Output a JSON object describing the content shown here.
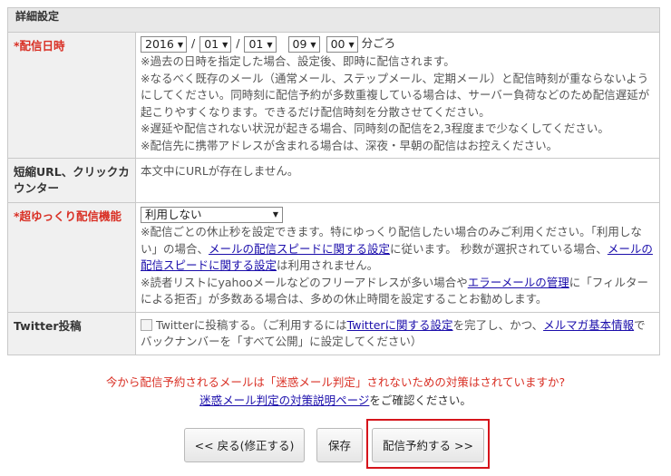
{
  "section": {
    "title": "詳細設定"
  },
  "rows": {
    "schedule": {
      "required_mark": "*",
      "label": "配信日時",
      "year": "2016",
      "month": "01",
      "day": "01",
      "hour": "09",
      "minute": "00",
      "sep_date": "/",
      "suffix": "分ごろ",
      "notes": [
        "※過去の日時を指定した場合、設定後、即時に配信されます。",
        "※なるべく既存のメール（通常メール、ステップメール、定期メール）と配信時刻が重ならないようにしてください。同時刻に配信予約が多数重複している場合は、サーバー負荷などのため配信遅延が起こりやすくなります。できるだけ配信時刻を分散させてください。",
        "※遅延や配信されない状況が起きる場合、同時刻の配信を2,3程度まで少なくしてください。",
        "※配信先に携帯アドレスが含まれる場合は、深夜・早朝の配信はお控えください。"
      ]
    },
    "short_url": {
      "label": "短縮URL、クリックカウンター",
      "value": "本文中にURLが存在しません。"
    },
    "slow": {
      "required_mark": "*",
      "label": "超ゆっくり配信機能",
      "select_value": "利用しない",
      "note1_a": "※配信ごとの休止秒を設定できます。特にゆっくり配信したい場合のみご利用ください。「利用しない」の場合、",
      "note1_link1": "メールの配信スピードに関する設定",
      "note1_b": "に従います。 秒数が選択されている場合、",
      "note1_link2": "メールの配信スピードに関する設定",
      "note1_c": "は利用されません。",
      "note2_a": "※読者リストにyahooメールなどのフリーアドレスが多い場合や",
      "note2_link": "エラーメールの管理",
      "note2_b": "に「フィルターによる拒否」が多数ある場合は、多めの休止時間を設定することお勧めします。"
    },
    "twitter": {
      "label": "Twitter投稿",
      "text_a": "Twitterに投稿する。（ご利用するには",
      "link1": "Twitterに関する設定",
      "text_b": "を完了し、かつ、",
      "link2": "メルマガ基本情報",
      "text_c": "でバックナンバーを「すべて公開」に設定してください）"
    }
  },
  "notice": {
    "warning": "今から配信予約されるメールは「迷惑メール判定」されないための対策はされていますか?",
    "link": "迷惑メール判定の対策説明ページ",
    "after_link": "をご確認ください。"
  },
  "buttons": {
    "back": "<< 戻る(修正する)",
    "save": "保存",
    "reserve": "配信予約する >>"
  },
  "colors": {
    "required": "#d93025",
    "highlight_border": "#d6141b",
    "link": "#1a0dab"
  }
}
